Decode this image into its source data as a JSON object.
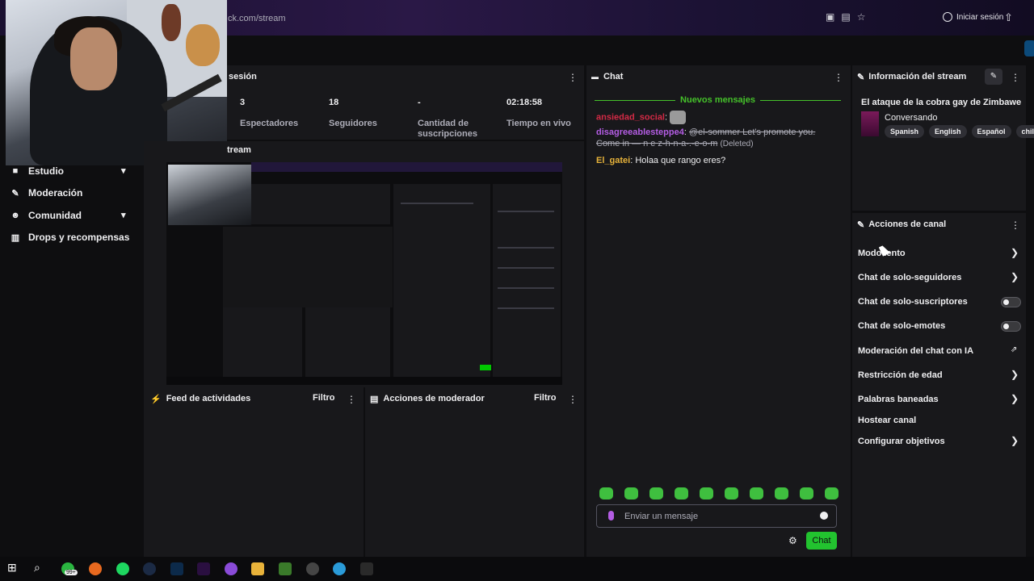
{
  "browser": {
    "url": "ck.com/stream",
    "signin_label": "Iniciar sesión"
  },
  "sidebar": {
    "items": [
      {
        "label": "Estudio",
        "icon": "camera-icon",
        "expandable": true
      },
      {
        "label": "Moderación",
        "icon": "wrench-icon",
        "expandable": false
      },
      {
        "label": "Comunidad",
        "icon": "people-icon",
        "expandable": true
      },
      {
        "label": "Drops y recompensas",
        "icon": "gift-icon",
        "expandable": false
      }
    ]
  },
  "session": {
    "title": "sesión",
    "stats": [
      {
        "value": "3",
        "label": "Espectadores"
      },
      {
        "value": "18",
        "label": "Seguidores"
      },
      {
        "value": "-",
        "label": "Cantidad de suscripciones"
      },
      {
        "value": "02:18:58",
        "label": "Tiempo en vivo"
      }
    ]
  },
  "stream_preview": {
    "title": "tream"
  },
  "activity_feed": {
    "title": "Feed de actividades",
    "filter_label": "Filtro"
  },
  "mod_actions": {
    "title": "Acciones de moderador",
    "filter_label": "Filtro"
  },
  "chat": {
    "title": "Chat",
    "new_messages_label": "Nuevos mensajes",
    "messages": [
      {
        "user": "ansiedad_social",
        "text": ""
      },
      {
        "user": "disagreeablesteppe4",
        "text": "@el-sommer Let's promote you. Come in — n e z-h-n-a-.-e-o-m",
        "note": "(Deleted)"
      },
      {
        "user": "El_gatei",
        "text": "Holaa que rango eres?"
      }
    ],
    "input_placeholder": "Enviar un mensaje",
    "send_label": "Chat"
  },
  "stream_info": {
    "title": "Información del stream",
    "stream_title": "El ataque de la cobra gay de Zimbawe",
    "category": "Conversando",
    "tags": [
      "Spanish",
      "English",
      "Español",
      "chill"
    ]
  },
  "channel_actions": {
    "title": "Acciones de canal",
    "items": [
      {
        "label": "Modo lento",
        "control": "chevron"
      },
      {
        "label": "Chat de solo-seguidores",
        "control": "chevron"
      },
      {
        "label": "Chat de solo-suscriptores",
        "control": "toggle",
        "on": false
      },
      {
        "label": "Chat de solo-emotes",
        "control": "toggle",
        "on": false
      },
      {
        "label": "Moderación del chat con IA",
        "control": "external"
      },
      {
        "label": "Restricción de edad",
        "control": "chevron"
      },
      {
        "label": "Palabras baneadas",
        "control": "chevron"
      },
      {
        "label": "Hostear canal",
        "control": "none"
      },
      {
        "label": "Configurar objetivos",
        "control": "chevron"
      }
    ]
  },
  "taskbar": {
    "notification_badge": "99+"
  },
  "colors": {
    "accent_green": "#22c32f",
    "bg": "#0e0e10",
    "panel": "#18181b",
    "purple": "#b45de4"
  }
}
